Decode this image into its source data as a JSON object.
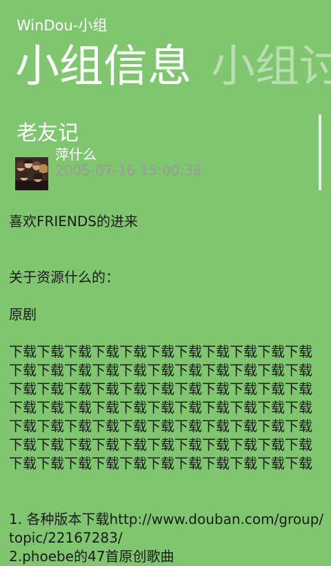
{
  "app": {
    "title": "WinDou-小组"
  },
  "pivot": {
    "headers": [
      "小组信息",
      "小组讨"
    ]
  },
  "post": {
    "title": "老友记",
    "author": "萍什么",
    "timestamp": "2005-07-16 15:00:38",
    "avatar_icon": "group-photo-avatar-icon",
    "paragraphs": [
      "喜欢FRIENDS的进来",
      "关于资源什么的：",
      "原剧",
      "下载下载下载下载下载下载下载下载下载下载下载下载下载下载下载下载下载下载下载下载下载下载下载下载下载下载下载下载下载下载下载下载下载下载下载下载下载下载下载下载下载下载下载下载下载下载下载下载下载下载下载下载下载下载下载下载下载下载下载下载下载下载下载下载下载下载下载下载下载下载下载下载下载下载下载下载下载",
      "1. 各种版本下载http://www.douban.com/group/topic/22167283/",
      "2.phoebe的47首原创歌曲"
    ]
  },
  "colors": {
    "background": "#80c56f",
    "accent_text": "#ffffff",
    "secondary_text": "#9a9a9a",
    "body_text": "#1b1b1b"
  }
}
